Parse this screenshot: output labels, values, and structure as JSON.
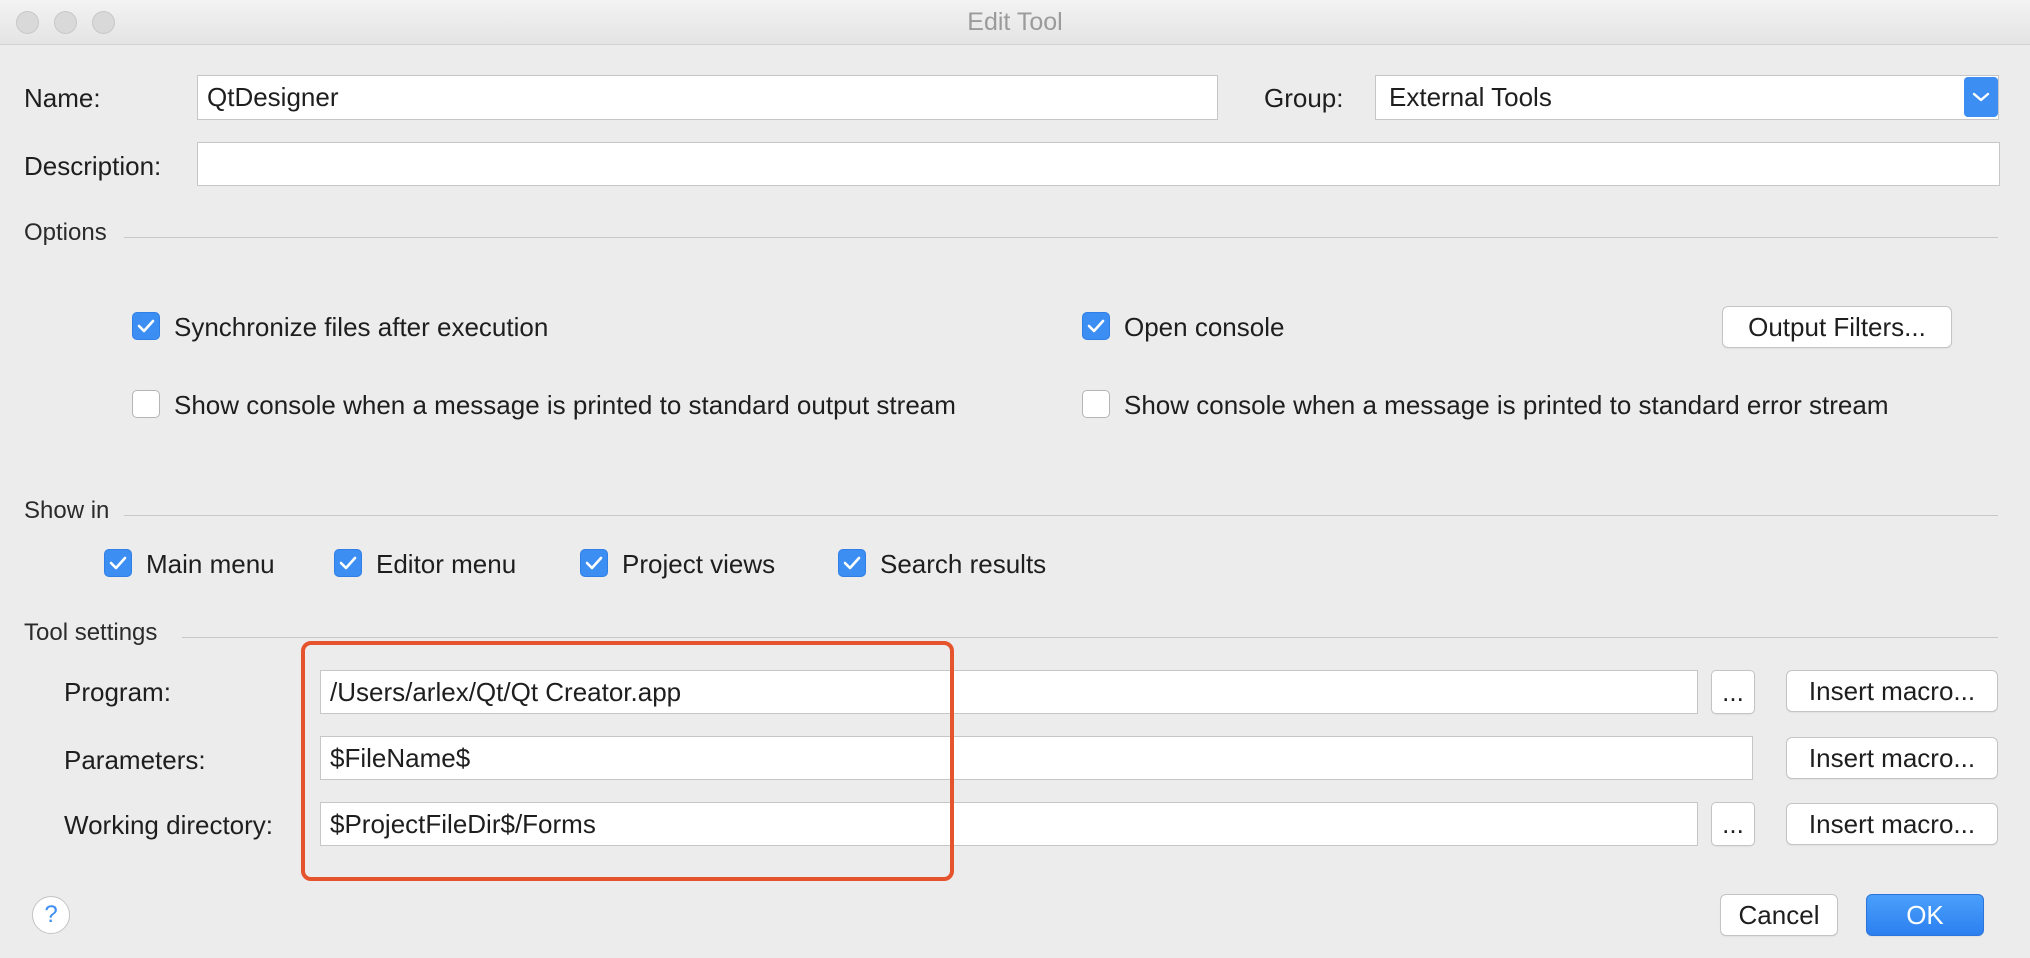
{
  "window": {
    "title": "Edit Tool"
  },
  "form": {
    "name_label": "Name:",
    "name_value": "QtDesigner",
    "group_label": "Group:",
    "group_value": "External Tools",
    "description_label": "Description:",
    "description_value": ""
  },
  "options": {
    "title": "Options",
    "sync_files": {
      "label": "Synchronize files after execution",
      "checked": true
    },
    "open_console": {
      "label": "Open console",
      "checked": true
    },
    "output_filters_label": "Output Filters...",
    "console_stdout": {
      "label": "Show console when a message is printed to standard output stream",
      "checked": false
    },
    "console_stderr": {
      "label": "Show console when a message is printed to standard error stream",
      "checked": false
    }
  },
  "show_in": {
    "title": "Show in",
    "main_menu": {
      "label": "Main menu",
      "checked": true
    },
    "editor_menu": {
      "label": "Editor menu",
      "checked": true
    },
    "project_views": {
      "label": "Project views",
      "checked": true
    },
    "search_results": {
      "label": "Search results",
      "checked": true
    }
  },
  "tool_settings": {
    "title": "Tool settings",
    "program_label": "Program:",
    "program_value": "/Users/arlex/Qt/Qt Creator.app",
    "parameters_label": "Parameters:",
    "parameters_value": "$FileName$",
    "working_dir_label": "Working directory:",
    "working_dir_value": "$ProjectFileDir$/Forms",
    "browse_label": "...",
    "insert_macro_label": "Insert macro..."
  },
  "footer": {
    "help_label": "?",
    "cancel_label": "Cancel",
    "ok_label": "OK"
  },
  "colors": {
    "accent": "#3d8ef3",
    "highlight": "#e5542c"
  }
}
